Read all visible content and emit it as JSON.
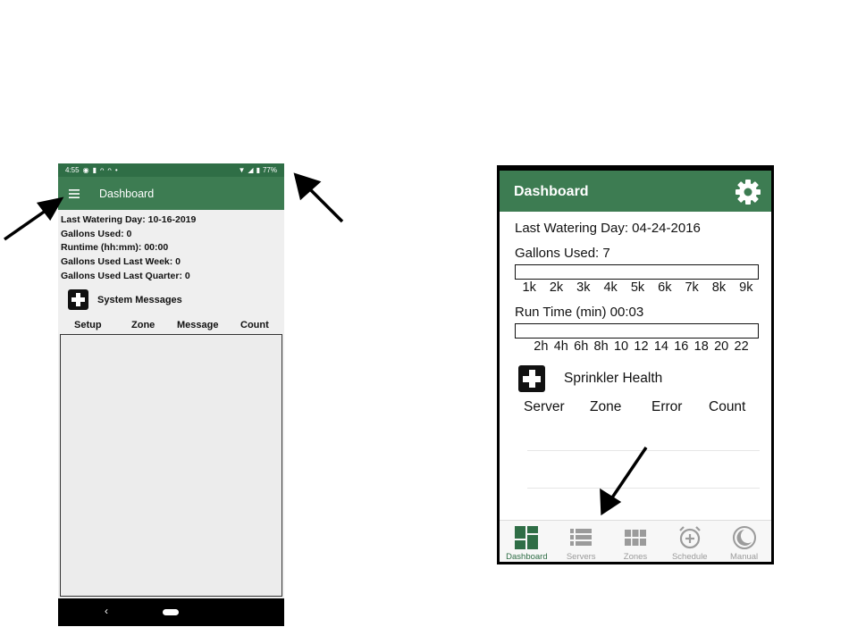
{
  "left_phone": {
    "status_bar": {
      "time": "4:55",
      "battery": "77%",
      "icons": [
        "whatsapp-icon",
        "usb-icon",
        "voicemail-icon",
        "voicemail-icon",
        "dot-icon",
        "wifi-icon",
        "signal-icon",
        "battery-icon"
      ]
    },
    "app_bar": {
      "menu_icon": "hamburger-icon",
      "title": "Dashboard",
      "color": "#3d7c52"
    },
    "stats": [
      "Last Watering Day: 10-16-2019",
      "Gallons Used: 0",
      "Runtime (hh:mm): 00:00",
      "Gallons Used Last Week: 0",
      "Gallons Used Last Quarter: 0"
    ],
    "system_messages": {
      "icon": "plus-box-icon",
      "label": "System Messages"
    },
    "columns": [
      "Setup",
      "Zone",
      "Message",
      "Count"
    ],
    "nav_bar": {
      "back_icon": "back-chevron-icon",
      "home_icon": "home-pill-icon"
    }
  },
  "right_phone": {
    "header": {
      "title": "Dashboard",
      "settings_icon": "gear-icon",
      "color": "#3d7c52"
    },
    "last_watering": "Last Watering Day: 04-24-2016",
    "gallons_used": "Gallons Used: 7",
    "gallons_ticks": [
      "1k",
      "2k",
      "3k",
      "4k",
      "5k",
      "6k",
      "7k",
      "8k",
      "9k"
    ],
    "runtime": "Run Time (min) 00:03",
    "runtime_ticks": [
      "2h",
      "4h",
      "6h",
      "8h",
      "10",
      "12",
      "14",
      "16",
      "18",
      "20",
      "22"
    ],
    "health": {
      "icon": "plus-box-icon",
      "label": "Sprinkler Health"
    },
    "columns": [
      "Server",
      "Zone",
      "Error",
      "Count"
    ],
    "tabs": [
      {
        "label": "Dashboard",
        "icon": "dashboard-icon",
        "active": true
      },
      {
        "label": "Servers",
        "icon": "list-icon",
        "active": false
      },
      {
        "label": "Zones",
        "icon": "grid-icon",
        "active": false
      },
      {
        "label": "Schedule",
        "icon": "alarm-clock-icon",
        "active": false
      },
      {
        "label": "Manual",
        "icon": "moon-icon",
        "active": false
      }
    ]
  },
  "annotations": [
    "arrow-icon",
    "arrow-icon",
    "arrow-icon"
  ]
}
